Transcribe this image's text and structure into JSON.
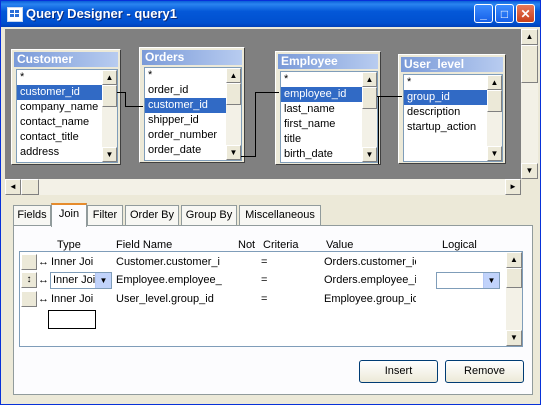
{
  "window": {
    "title": "Query Designer - query1"
  },
  "tables": [
    {
      "name": "Customer",
      "fields": [
        "*",
        "customer_id",
        "company_name",
        "contact_name",
        "contact_title",
        "address"
      ],
      "selected": 1
    },
    {
      "name": "Orders",
      "fields": [
        "*",
        "order_id",
        "customer_id",
        "shipper_id",
        "order_number",
        "order_date"
      ],
      "selected": 2
    },
    {
      "name": "Employee",
      "fields": [
        "*",
        "employee_id",
        "last_name",
        "first_name",
        "title",
        "birth_date"
      ],
      "selected": 1
    },
    {
      "name": "User_level",
      "fields": [
        "*",
        "group_id",
        "description",
        "startup_action"
      ],
      "selected": 1
    }
  ],
  "tabs": [
    {
      "label": "Fields",
      "active": false
    },
    {
      "label": "Join",
      "active": true
    },
    {
      "label": "Filter",
      "active": false
    },
    {
      "label": "Order By",
      "active": false
    },
    {
      "label": "Group By",
      "active": false
    },
    {
      "label": "Miscellaneous",
      "active": false
    }
  ],
  "grid": {
    "headers": {
      "type": "Type",
      "field": "Field Name",
      "not": "Not",
      "criteria": "Criteria",
      "value": "Value",
      "logical": "Logical"
    },
    "rows": [
      {
        "type": "Inner Joi",
        "field": "Customer.customer_i",
        "criteria": "=",
        "value": "Orders.customer_ic"
      },
      {
        "type": "Inner Joi",
        "field": "Employee.employee_",
        "criteria": "=",
        "value": "Orders.employee_i"
      },
      {
        "type": "Inner Joi",
        "field": "User_level.group_id",
        "criteria": "=",
        "value": "Employee.group_ic"
      }
    ]
  },
  "buttons": {
    "insert": "Insert",
    "remove": "Remove"
  },
  "icons": {
    "join": "↔",
    "reorder": "↕",
    "dropdown": "▼",
    "up": "▲",
    "left": "◄",
    "right": "►"
  }
}
